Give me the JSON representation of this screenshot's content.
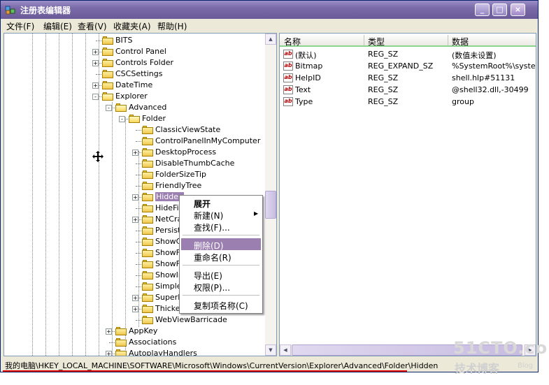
{
  "window": {
    "title": "注册表编辑器",
    "buttons": [
      "_",
      "□",
      "×"
    ]
  },
  "menu": [
    "文件(F)",
    "编辑(E)",
    "查看(V)",
    "收藏夹(A)",
    "帮助(H)"
  ],
  "tree": {
    "items": [
      {
        "label": "BITS",
        "expander": ""
      },
      {
        "label": "Control Panel",
        "expander": "+"
      },
      {
        "label": "Controls Folder",
        "expander": "+"
      },
      {
        "label": "CSCSettings",
        "expander": ""
      },
      {
        "label": "DateTime",
        "expander": "+"
      },
      {
        "label": "Explorer",
        "expander": "-"
      },
      {
        "label": "Advanced",
        "expander": "-"
      },
      {
        "label": "Folder",
        "expander": "-"
      },
      {
        "label": "ClassicViewState",
        "expander": ""
      },
      {
        "label": "ControlPanelInMyComputer",
        "expander": ""
      },
      {
        "label": "DesktopProcess",
        "expander": "+"
      },
      {
        "label": "DisableThumbCache",
        "expander": ""
      },
      {
        "label": "FolderSizeTip",
        "expander": ""
      },
      {
        "label": "FriendlyTree",
        "expander": ""
      },
      {
        "label": "Hidden",
        "expander": "+"
      },
      {
        "label": "HideFile",
        "expander": ""
      },
      {
        "label": "NetCraw",
        "expander": "+"
      },
      {
        "label": "PersistB",
        "expander": ""
      },
      {
        "label": "ShowCo",
        "expander": ""
      },
      {
        "label": "ShowFu",
        "expander": ""
      },
      {
        "label": "ShowFu",
        "expander": ""
      },
      {
        "label": "ShowIn",
        "expander": ""
      },
      {
        "label": "SimpleS",
        "expander": ""
      },
      {
        "label": "SuperHi",
        "expander": "+"
      },
      {
        "label": "Thicket",
        "expander": "+"
      },
      {
        "label": "WebViewBarricade",
        "expander": ""
      },
      {
        "label": "AppKey",
        "expander": "+"
      },
      {
        "label": "Associations",
        "expander": ""
      },
      {
        "label": "AutoplayHandlers",
        "expander": "+"
      }
    ]
  },
  "values": {
    "headers": [
      "名称",
      "类型",
      "数据"
    ],
    "rows": [
      {
        "name": "(默认)",
        "type": "REG_SZ",
        "data": "(数值未设置)"
      },
      {
        "name": "Bitmap",
        "type": "REG_EXPAND_SZ",
        "data": "%SystemRoot%\\system"
      },
      {
        "name": "HelpID",
        "type": "REG_SZ",
        "data": "shell.hlp#51131"
      },
      {
        "name": "Text",
        "type": "REG_SZ",
        "data": "@shell32.dll,-30499"
      },
      {
        "name": "Type",
        "type": "REG_SZ",
        "data": "group"
      }
    ],
    "icon_glyph": "ab"
  },
  "context_menu": {
    "items": [
      "展开",
      "新建(N)",
      "查找(F)...",
      "删除(D)",
      "重命名(R)",
      "导出(E)",
      "权限(P)...",
      "复制项名称(C)"
    ],
    "highlighted": "删除(D)",
    "submenu_arrow": "▶"
  },
  "statusbar": {
    "path": "我的电脑\\HKEY_LOCAL_MACHINE\\SOFTWARE\\Microsoft\\Windows\\CurrentVersion\\Explorer\\Advanced\\Folder\\Hidden"
  },
  "watermark": {
    "site": "51CTO.com",
    "label": "技术博客",
    "blog": "Blog"
  },
  "colors": {
    "titlebar": "#7a6aa8",
    "selection": "#9b7fb0",
    "status_underline": "#e00000"
  }
}
